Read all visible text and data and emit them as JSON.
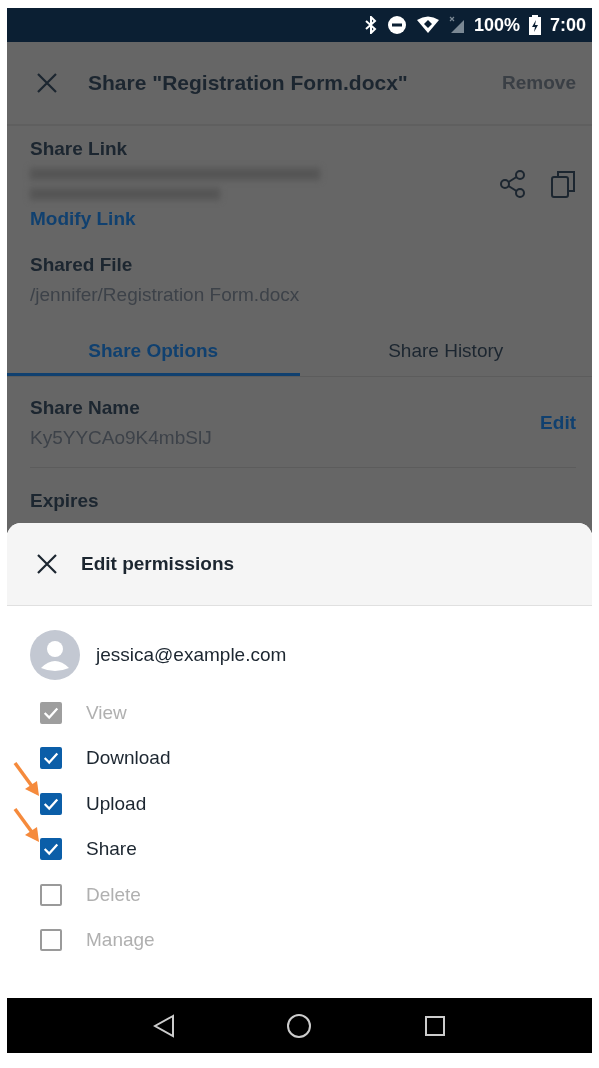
{
  "status_bar": {
    "battery": "100%",
    "time": "7:00"
  },
  "app_bar": {
    "title": "Share \"Registration Form.docx\"",
    "action": "Remove"
  },
  "share_link": {
    "label": "Share Link",
    "modify": "Modify Link"
  },
  "shared_file": {
    "label": "Shared File",
    "path": "/jennifer/Registration Form.docx"
  },
  "tabs": [
    {
      "label": "Share Options",
      "selected": true
    },
    {
      "label": "Share History",
      "selected": false
    }
  ],
  "share_name": {
    "label": "Share Name",
    "value": "Ky5YYCAo9K4mbSlJ",
    "action": "Edit"
  },
  "expires": {
    "label": "Expires"
  },
  "sheet": {
    "title": "Edit permissions",
    "user": "jessica@example.com",
    "permissions": [
      {
        "label": "View",
        "checked": true,
        "disabled": true,
        "annotated": false
      },
      {
        "label": "Download",
        "checked": true,
        "disabled": false,
        "annotated": false
      },
      {
        "label": "Upload",
        "checked": true,
        "disabled": false,
        "annotated": true
      },
      {
        "label": "Share",
        "checked": true,
        "disabled": false,
        "annotated": true
      },
      {
        "label": "Delete",
        "checked": false,
        "disabled": true,
        "annotated": false
      },
      {
        "label": "Manage",
        "checked": false,
        "disabled": true,
        "annotated": false
      }
    ]
  }
}
